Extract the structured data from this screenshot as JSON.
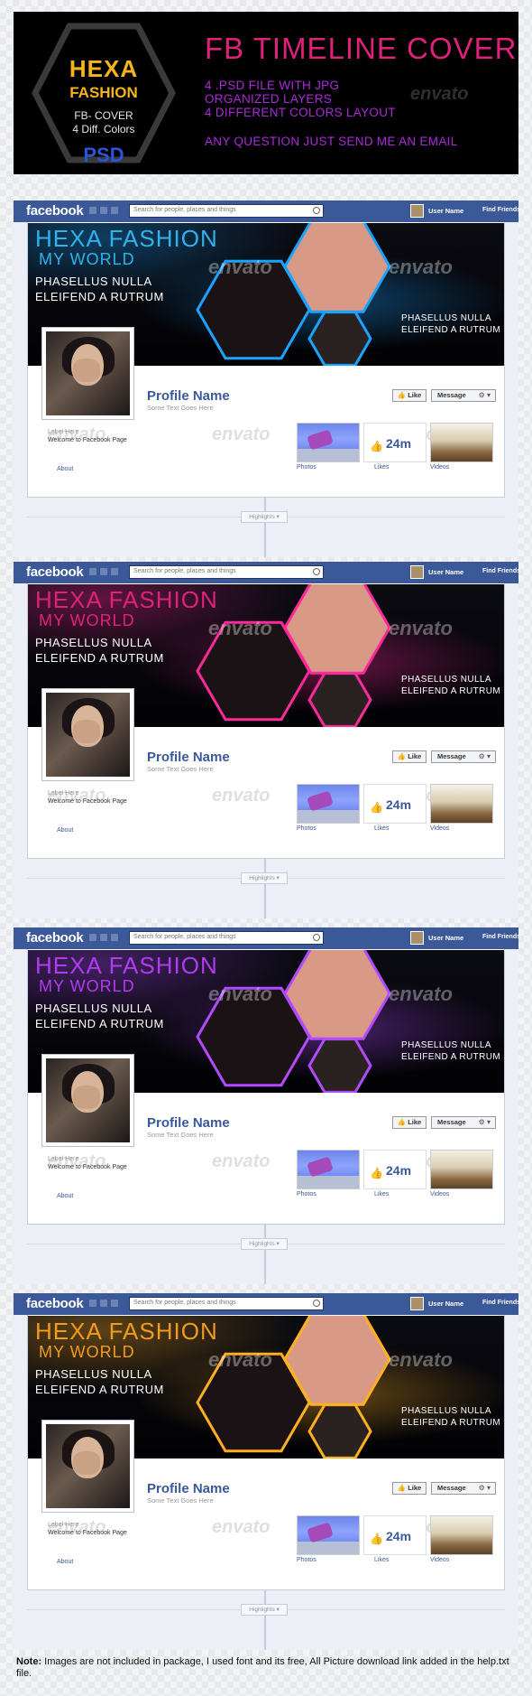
{
  "banner": {
    "logo_hexa": "HEXA",
    "logo_fashion": "FASHION",
    "logo_line1": "FB- COVER",
    "logo_line2": "4 Diff. Colors",
    "logo_psd": "PSD",
    "title": "FB TIMELINE COVER",
    "features": [
      "4 .PSD FILE WITH JPG",
      "ORGANIZED LAYERS",
      "4 DIFFERENT COLORS LAYOUT"
    ],
    "question": "ANY QUESTION JUST SEND ME AN EMAIL",
    "watermark": "envato"
  },
  "facebook": {
    "logo": "facebook",
    "search_placeholder": "Search for people, places and things",
    "user_name": "User Name",
    "find_friends": "Find Friends"
  },
  "cover": {
    "title": "HEXA FASHION",
    "subtitle": "MY WORLD",
    "line1": "PHASELLUS NULLA",
    "line2": "ELEIFEND A RUTRUM",
    "right1": "PHASELLUS NULLA",
    "right2": "ELEIFEND A RUTRUM"
  },
  "profile": {
    "name": "Profile Name",
    "desc": "Some Text Goes Here",
    "like_btn": "Like",
    "message_btn": "Message",
    "label": "Label Here",
    "welcome": "Welcome to Facebook Page",
    "about": "About",
    "photos": "Photos",
    "likes": "Likes",
    "likes_count": "24m",
    "videos": "Videos",
    "highlights": "Highlights ▾"
  },
  "variants": [
    {
      "name": "blue",
      "title_color": "#2fb3ea",
      "sub_color": "#2fb3ea",
      "glow": "#1aa3ff"
    },
    {
      "name": "pink",
      "title_color": "#e0217b",
      "sub_color": "#e0217b",
      "glow": "#ff2a9a"
    },
    {
      "name": "purple",
      "title_color": "#b13bf0",
      "sub_color": "#b13bf0",
      "glow": "#b24bff"
    },
    {
      "name": "orange",
      "title_color": "#f29b1c",
      "sub_color": "#f29b1c",
      "glow": "#ffb020"
    }
  ],
  "note": {
    "label": "Note:",
    "text": "Images are not included in package, I used font and its free, All Picture download link added in the help.txt file."
  }
}
